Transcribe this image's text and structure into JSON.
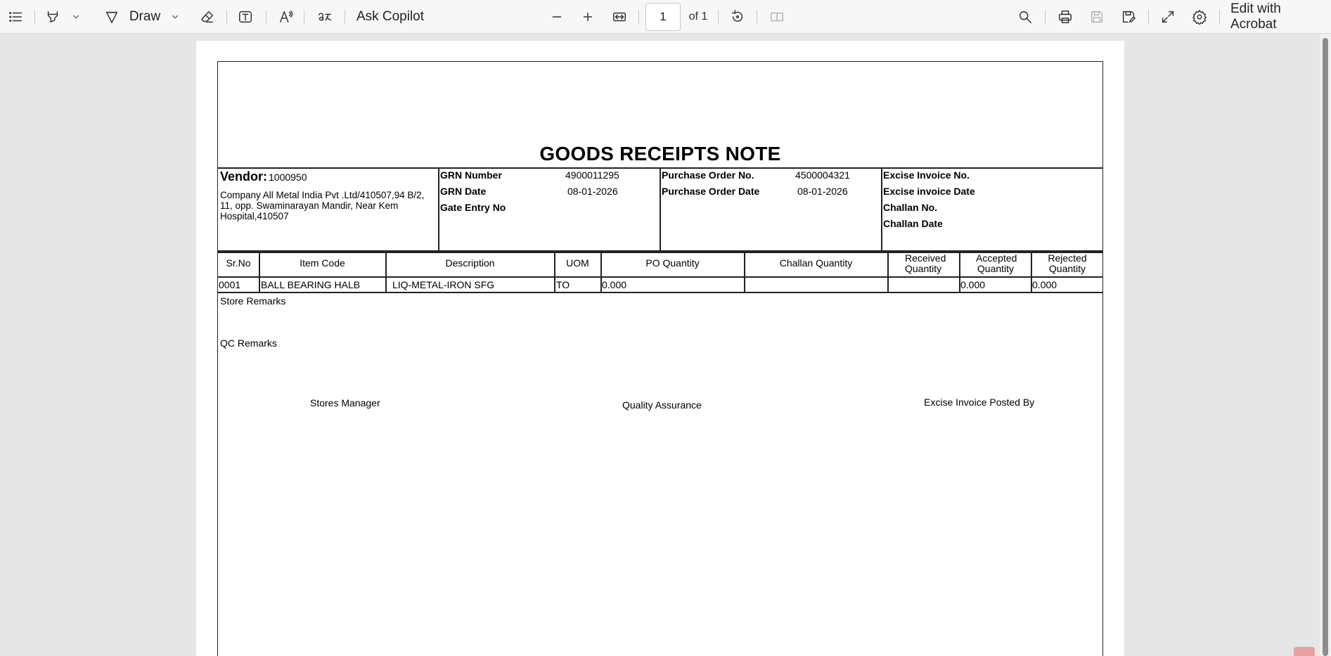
{
  "toolbar": {
    "draw_label": "Draw",
    "ask_copilot": "Ask Copilot",
    "page_current": "1",
    "page_total": "of 1",
    "edit_acrobat": "Edit with Acrobat",
    "icons": [
      "contents-icon",
      "highlight-icon",
      "chevron-down-icon",
      "draw-icon",
      "eraser-icon",
      "text-box-icon",
      "read-aloud-icon",
      "translate-icon",
      "zoom-out-icon",
      "zoom-in-icon",
      "fit-width-icon",
      "rotate-icon",
      "page-view-icon",
      "search-icon",
      "print-icon",
      "save-icon",
      "save-as-icon",
      "fullscreen-icon",
      "settings-icon"
    ]
  },
  "document": {
    "title": "GOODS RECEIPTS NOTE",
    "vendor_label": "Vendor:",
    "vendor_code": "1000950",
    "vendor_address": "Company All Metal India Pvt .Ltd/410507,94 B/2, 11, opp. Swaminarayan Mandir, Near Kem Hospital,410507",
    "grn_number_label": "GRN Number",
    "grn_number": "4900011295",
    "grn_date_label": "GRN Date",
    "grn_date": "08-01-2026",
    "gate_entry_label": "Gate Entry No",
    "po_no_label": "Purchase Order No.",
    "po_no": "4500004321",
    "po_date_label": "Purchase Order Date",
    "po_date": "08-01-2026",
    "excise_invoice_no_label": "Excise Invoice No.",
    "excise_invoice_date_label": "Excise invoice Date",
    "challan_no_label": "Challan No.",
    "challan_date_label": "Challan Date",
    "columns": [
      "Sr.No",
      "Item Code",
      "Description",
      "UOM",
      "PO Quantity",
      "Challan Quantity",
      "Received Quantity",
      "Accepted Quantity",
      "Rejected Quantity"
    ],
    "rows": [
      [
        "0001",
        "BALL BEARING HALB",
        "LIQ-METAL-IRON SFG",
        "TO",
        "0.000",
        "",
        "",
        "0.000",
        "0.000"
      ]
    ],
    "store_remarks_label": "Store Remarks",
    "qc_remarks_label": "QC Remarks",
    "signatures": [
      "Stores Manager",
      "Quality Assurance",
      "Excise Invoice Posted By"
    ]
  }
}
